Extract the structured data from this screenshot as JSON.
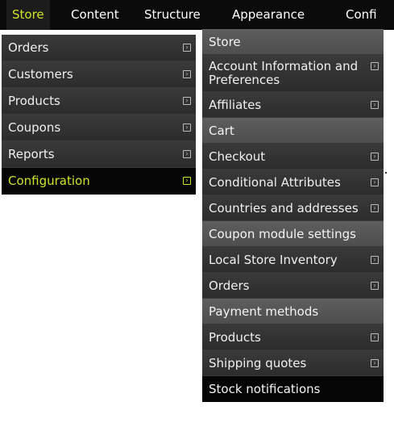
{
  "top_nav": {
    "items": [
      "Store",
      "Content",
      "Structure",
      "Appearance",
      "Confi"
    ]
  },
  "left_menu": {
    "items": [
      "Orders",
      "Customers",
      "Products",
      "Coupons",
      "Reports",
      "Configuration"
    ]
  },
  "right_menu": {
    "items": [
      "Store",
      "Account Information and Preferences",
      "Affiliates",
      "Cart",
      "Checkout",
      "Conditional Attributes",
      "Countries and addresses",
      "Coupon module settings",
      "Local Store Inventory",
      "Orders",
      "Payment methods",
      "Products",
      "Shipping quotes",
      "Stock notifications"
    ]
  },
  "icons": {
    "submenu_arrow": "submenu-arrow-icon"
  },
  "colors": {
    "accent": "#cfe32a",
    "menu_bg": "#2c2c2c",
    "category_bg": "#555555",
    "active_bg": "#050505"
  }
}
